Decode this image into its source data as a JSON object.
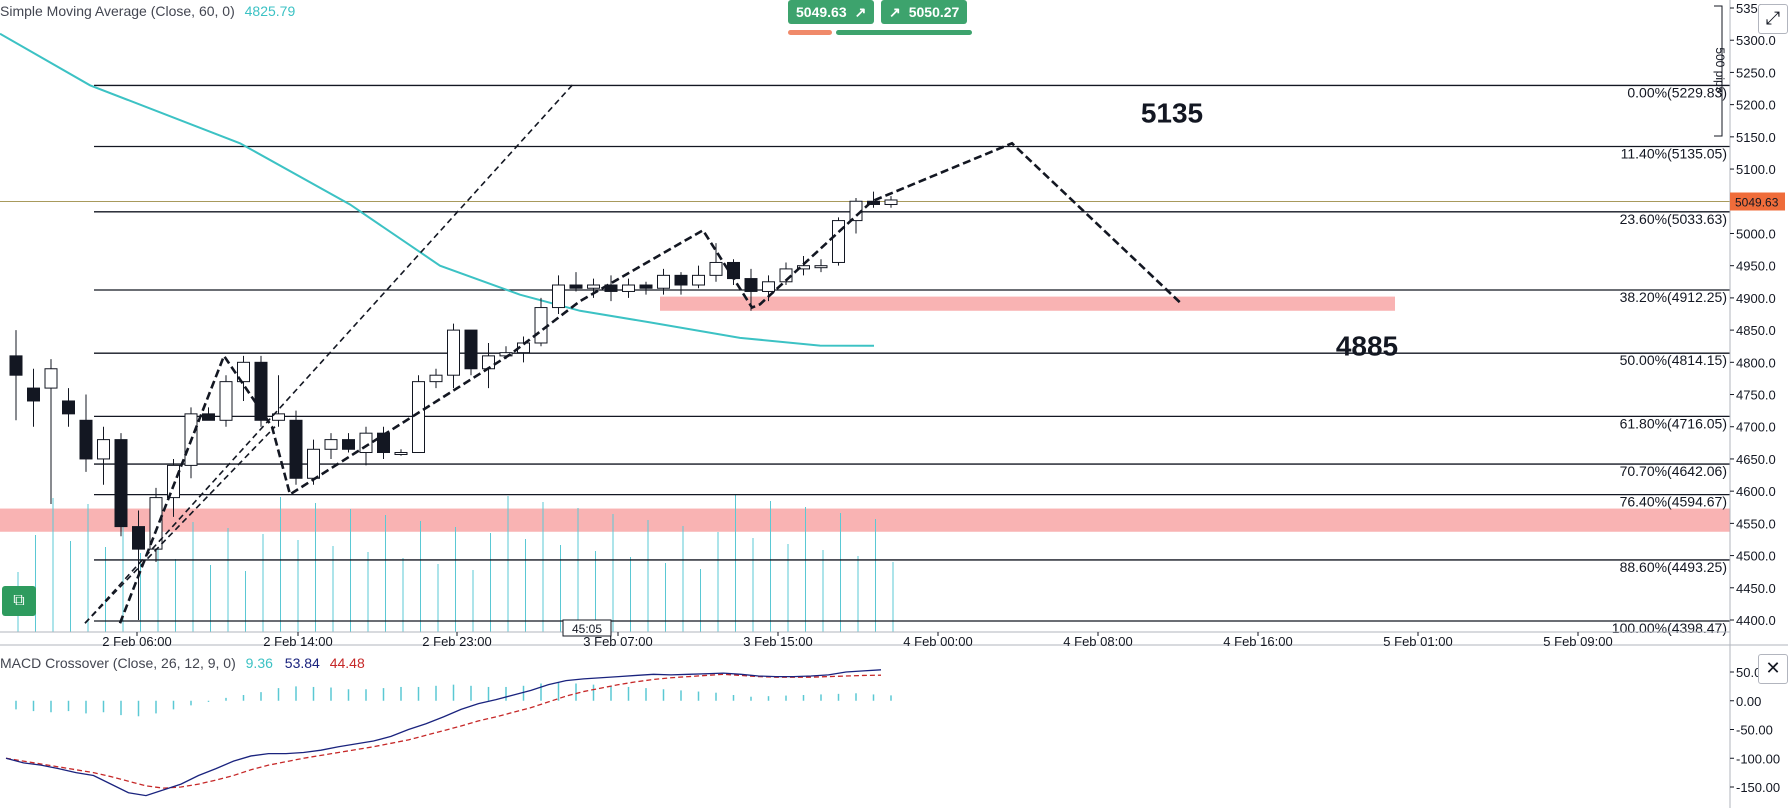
{
  "indicator_header": {
    "name": "Simple Moving Average (Close, 60, 0)",
    "value": "4825.79"
  },
  "quotes": {
    "sell": "5049.63",
    "buy": "5050.27",
    "sell_color": "#3da36d",
    "buy_color": "#3da36d",
    "sell_bar_color": "#f08a6a",
    "buy_bar_color": "#3da36d"
  },
  "pips_label": "500 pips",
  "macd_header": {
    "name": "MACD Crossover (Close, 26, 12, 9, 0)",
    "hist": "9.36",
    "macd": "53.84",
    "signal": "44.48"
  },
  "colors": {
    "sma": "#3cc2c4",
    "zone": "#f8a6a6",
    "price_tag": "#ef6c3a",
    "macd_line": "#1a237e",
    "signal_line": "#c62828",
    "hist": "#5bc8d4"
  },
  "icons": {
    "expand": "expand-icon",
    "close": "close-icon",
    "tool": "drawing-tool-icon"
  },
  "chart_data": {
    "type": "candlestick",
    "ylim": [
      4390,
      5355
    ],
    "y_ticks": [
      "5350.0",
      "5300.0",
      "5250.0",
      "5200.0",
      "5150.0",
      "5100.0",
      "5050.0",
      "5000.0",
      "4950.0",
      "4900.0",
      "4850.0",
      "4800.0",
      "4750.0",
      "4700.0",
      "4650.0",
      "4600.0",
      "4550.0",
      "4500.0",
      "4450.0",
      "4400.0"
    ],
    "x_ticks": [
      "2 Feb 06:00",
      "2 Feb 14:00",
      "2 Feb 23:00",
      "3 Feb 07:00",
      "3 Feb 15:00",
      "4 Feb 00:00",
      "4 Feb 08:00",
      "4 Feb 16:00",
      "5 Feb 01:00",
      "5 Feb 09:00"
    ],
    "crosshair_time": "45:05",
    "current_price": "5049.63",
    "current_price_value": 5049.63,
    "fib_levels": [
      {
        "label": "0.00%(5229.83)",
        "value": 5229.83
      },
      {
        "label": "11.40%(5135.05)",
        "value": 5135.05
      },
      {
        "label": "23.60%(5033.63)",
        "value": 5033.63
      },
      {
        "label": "38.20%(4912.25)",
        "value": 4912.25
      },
      {
        "label": "50.00%(4814.15)",
        "value": 4814.15
      },
      {
        "label": "61.80%(4716.05)",
        "value": 4716.05
      },
      {
        "label": "70.70%(4642.06)",
        "value": 4642.06
      },
      {
        "label": "76.40%(4594.67)",
        "value": 4594.67
      },
      {
        "label": "88.60%(4493.25)",
        "value": 4493.25
      },
      {
        "label": "100.00%(4398.47)",
        "value": 4398.47
      }
    ],
    "annotations": [
      {
        "text": "5135",
        "value": 5135
      },
      {
        "text": "4885",
        "value": 4885
      }
    ],
    "zones": [
      {
        "from": 4880,
        "to": 4902
      },
      {
        "from": 4537,
        "to": 4573
      }
    ],
    "candles": [
      [
        4810,
        4850,
        4710,
        4780
      ],
      [
        4760,
        4790,
        4700,
        4740
      ],
      [
        4760,
        4805,
        4580,
        4790
      ],
      [
        4740,
        4760,
        4700,
        4720
      ],
      [
        4710,
        4750,
        4630,
        4650
      ],
      [
        4650,
        4700,
        4610,
        4680
      ],
      [
        4680,
        4690,
        4530,
        4545
      ],
      [
        4545,
        4570,
        4400,
        4510
      ],
      [
        4510,
        4605,
        4490,
        4590
      ],
      [
        4590,
        4650,
        4560,
        4640
      ],
      [
        4640,
        4730,
        4620,
        4720
      ],
      [
        4720,
        4730,
        4710,
        4710
      ],
      [
        4710,
        4780,
        4700,
        4770
      ],
      [
        4770,
        4810,
        4740,
        4800
      ],
      [
        4800,
        4810,
        4700,
        4710
      ],
      [
        4710,
        4780,
        4700,
        4720
      ],
      [
        4710,
        4725,
        4610,
        4620
      ],
      [
        4620,
        4680,
        4610,
        4665
      ],
      [
        4665,
        4690,
        4650,
        4680
      ],
      [
        4680,
        4690,
        4660,
        4665
      ],
      [
        4660,
        4700,
        4640,
        4690
      ],
      [
        4690,
        4700,
        4650,
        4660
      ],
      [
        4660,
        4665,
        4655,
        4660
      ],
      [
        4660,
        4780,
        4670,
        4770
      ],
      [
        4770,
        4790,
        4760,
        4780
      ],
      [
        4780,
        4860,
        4760,
        4850
      ],
      [
        4850,
        4850,
        4780,
        4790
      ],
      [
        4790,
        4830,
        4760,
        4810
      ],
      [
        4810,
        4825,
        4805,
        4815
      ],
      [
        4815,
        4840,
        4800,
        4830
      ],
      [
        4830,
        4900,
        4825,
        4885
      ],
      [
        4885,
        4935,
        4875,
        4920
      ],
      [
        4920,
        4940,
        4910,
        4915
      ],
      [
        4915,
        4930,
        4900,
        4920
      ],
      [
        4920,
        4935,
        4895,
        4910
      ],
      [
        4910,
        4930,
        4900,
        4920
      ],
      [
        4920,
        4925,
        4905,
        4915
      ],
      [
        4915,
        4945,
        4905,
        4935
      ],
      [
        4935,
        4940,
        4905,
        4920
      ],
      [
        4920,
        4950,
        4915,
        4935
      ],
      [
        4935,
        4985,
        4925,
        4955
      ],
      [
        4955,
        4960,
        4920,
        4930
      ],
      [
        4930,
        4945,
        4880,
        4910
      ],
      [
        4910,
        4935,
        4895,
        4925
      ],
      [
        4925,
        4955,
        4920,
        4945
      ],
      [
        4945,
        4965,
        4935,
        4950
      ],
      [
        4950,
        4960,
        4940,
        4950
      ],
      [
        4955,
        5025,
        4950,
        5020
      ],
      [
        5020,
        5055,
        5000,
        5050
      ],
      [
        5050,
        5065,
        5040,
        5045
      ],
      [
        5045,
        5058,
        5040,
        5052
      ]
    ],
    "candle_start_x": 10,
    "candle_step": 17.5,
    "sma_points": [
      [
        5310,
        0
      ],
      [
        5230,
        90
      ],
      [
        5140,
        240
      ],
      [
        5045,
        350
      ],
      [
        4950,
        440
      ],
      [
        4905,
        520
      ],
      [
        4880,
        580
      ],
      [
        4862,
        650
      ],
      [
        4838,
        740
      ],
      [
        4826,
        820
      ],
      [
        4825.79,
        874
      ]
    ],
    "pattern_lines": [
      {
        "dash": "6,4",
        "pts": [
          [
            4395,
            85
          ],
          [
            5235,
            575
          ]
        ]
      },
      {
        "dash": "6,4",
        "pts": [
          [
            4395,
            85
          ],
          [
            4700,
            275
          ]
        ]
      },
      {
        "dash": "8,4",
        "pts": [
          [
            4395,
            120
          ],
          [
            4810,
            224
          ],
          [
            4700,
            272
          ],
          [
            4595,
            290
          ],
          [
            4812,
            510
          ],
          [
            4895,
            580
          ],
          [
            5005,
            703
          ],
          [
            4885,
            752
          ],
          [
            4890,
            760
          ],
          [
            5050,
            872
          ],
          [
            5140,
            1012
          ],
          [
            4890,
            1182
          ]
        ]
      }
    ],
    "macd": {
      "ylim": [
        -190,
        70
      ],
      "y_ticks": [
        "50.00",
        "0.00",
        "-50.00",
        "-100.00",
        "-150.00"
      ],
      "hist": [
        -15,
        -18,
        -20,
        -18,
        -22,
        -20,
        -25,
        -27,
        -22,
        -15,
        -8,
        -2,
        5,
        10,
        15,
        22,
        25,
        24,
        23,
        20,
        20,
        22,
        24,
        24,
        26,
        28,
        26,
        24,
        24,
        26,
        30,
        32,
        30,
        28,
        26,
        24,
        22,
        20,
        18,
        16,
        14,
        10,
        7,
        8,
        9,
        10,
        11,
        12,
        13,
        11,
        9.36
      ],
      "macd_line": [
        -100,
        -108,
        -112,
        -118,
        -125,
        -130,
        -145,
        -160,
        -165,
        -155,
        -145,
        -130,
        -118,
        -105,
        -96,
        -92,
        -92,
        -90,
        -86,
        -80,
        -75,
        -70,
        -62,
        -50,
        -40,
        -28,
        -15,
        -5,
        2,
        10,
        18,
        28,
        35,
        38,
        40,
        42,
        44,
        46,
        45,
        46,
        47,
        48,
        46,
        43,
        42,
        42,
        43,
        45,
        50,
        52,
        53.84
      ],
      "signal_line": [
        -100,
        -105,
        -110,
        -115,
        -120,
        -125,
        -132,
        -140,
        -148,
        -152,
        -150,
        -145,
        -138,
        -130,
        -120,
        -112,
        -106,
        -100,
        -95,
        -90,
        -85,
        -80,
        -74,
        -68,
        -60,
        -52,
        -44,
        -35,
        -28,
        -20,
        -12,
        -2,
        8,
        16,
        22,
        28,
        33,
        37,
        40,
        42,
        44,
        46,
        44,
        42,
        41,
        41,
        41,
        42,
        43,
        44,
        44.48
      ]
    }
  }
}
